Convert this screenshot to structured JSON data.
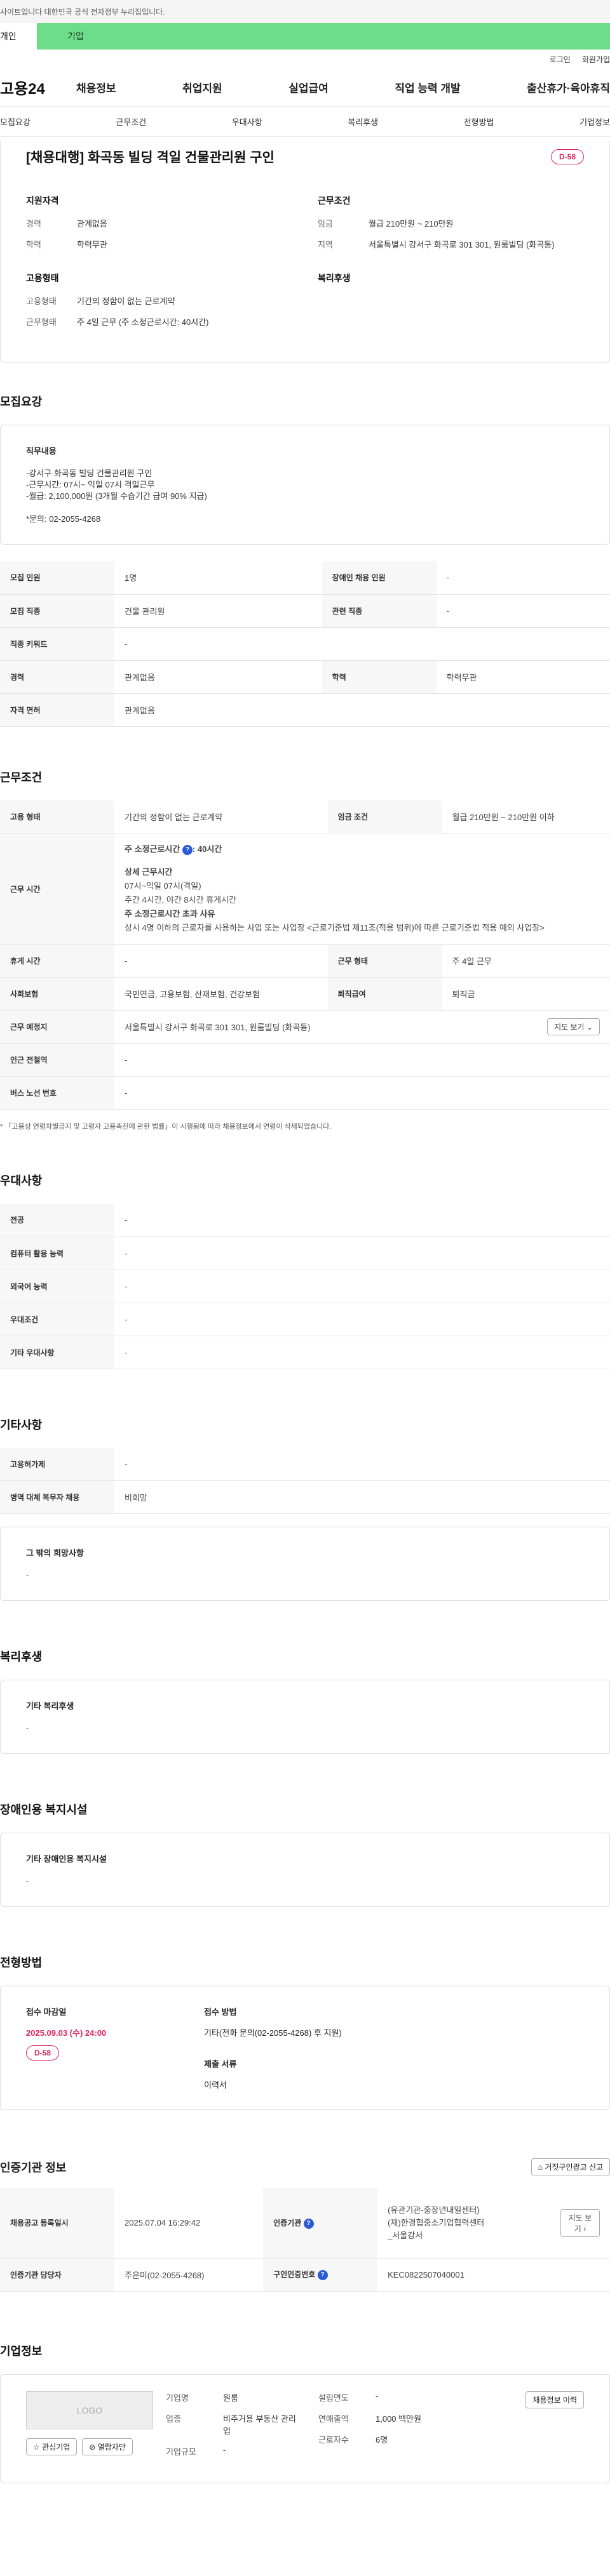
{
  "gov_notice": "사이트입니다 대한민국 공식 전자정부 누리집입니다.",
  "type_tabs": {
    "personal": "개인",
    "company": "기업"
  },
  "util": {
    "login": "로그인",
    "join": "회원가입"
  },
  "gnb": {
    "logo": "고용24",
    "menu": [
      "채용정보",
      "취업지원",
      "실업급여",
      "직업 능력 개발",
      "출산휴가·육아휴직"
    ]
  },
  "sub_tabs": [
    "모집요강",
    "근무조건",
    "우대사항",
    "복리후생",
    "전형방법",
    "기업정보"
  ],
  "job": {
    "title": "[채용대행] 화곡동 빌딩 격일 건물관리원 구인",
    "dday": "D-58",
    "summary": {
      "qual_title": "지원자격",
      "qual": [
        {
          "k": "경력",
          "v": "관계없음"
        },
        {
          "k": "학력",
          "v": "학력무관"
        }
      ],
      "cond_title": "근무조건",
      "cond": [
        {
          "k": "임금",
          "v": "월급 210만원 ~ 210만원"
        },
        {
          "k": "지역",
          "v": "서울특별시 강서구 화곡로 301 301, 원룸빌딩 (화곡동)"
        }
      ],
      "emp_title": "고용형태",
      "emp": [
        {
          "k": "고용형태",
          "v": "기간의 정함이 없는 근로계약"
        },
        {
          "k": "근무형태",
          "v": "주 4일 근무 (주 소정근로시간: 40시간)"
        }
      ],
      "welfare_title": "복리후생"
    }
  },
  "recruit": {
    "section_title": "모집요강",
    "duty_title": "직무내용",
    "duty_lines": [
      "-강서구 화곡동 빌딩 건물관리원 구인",
      "-근무시간: 07시~ 익일 07시 격일근무",
      "-월급: 2,100,000원 (3개월 수습기간 급여 90% 지급)",
      "",
      "*문의: 02-2055-4268"
    ],
    "rows": [
      {
        "k1": "모집 인원",
        "v1": "1명",
        "k2": "장애인 채용 인원",
        "v2": "-"
      },
      {
        "k1": "모집 직종",
        "v1": "건물 관리원",
        "k2": "관련 직종",
        "v2": "-"
      },
      {
        "k1": "직종 키워드",
        "v1": "-",
        "k2": "",
        "v2": ""
      },
      {
        "k1": "경력",
        "v1": "관계없음",
        "k2": "학력",
        "v2": "학력무관"
      },
      {
        "k1": "자격 면허",
        "v1": "관계없음",
        "k2": "",
        "v2": ""
      }
    ]
  },
  "conditions": {
    "section_title": "근무조건",
    "emp_type_k": "고용 형태",
    "emp_type_v": "기간의 정함이 없는 근로계약",
    "wage_k": "임금 조건",
    "wage_v": "월급 210만원 ~ 210만원 이하",
    "hours_k": "근무 시간",
    "hours_main": "주 소정근로시간",
    "hours_main_v": ": 40시간",
    "hours_detail_title": "상세 근무시간",
    "hours_detail": [
      "07시~익일 07시(격일)",
      "주간 4시간, 야간 8시간 휴게시간"
    ],
    "hours_over_title": "주 소정근로시간 초과 사유",
    "hours_over": "상시 4명 이하의 근로자를 사용하는 사업 또는 사업장 <근로기준법 제11조(적용 범위)에 따른 근로기준법 적용 예외 사업장>",
    "holiday_k": "휴게 시간",
    "holiday_v": "-",
    "worktype_k": "근무 형태",
    "worktype_v": "주 4일 근무",
    "insurance_k": "사회보험",
    "insurance_v": "국민연금, 고용보험, 산재보험, 건강보험",
    "retire_k": "퇴직급여",
    "retire_v": "퇴직금",
    "place_k": "근무 예정지",
    "place_v": "서울특별시 강서구 화곡로 301 301, 원룸빌딩 (화곡동)",
    "map_btn": "지도 보기",
    "subway_k": "인근 전철역",
    "subway_v": "-",
    "bus_k": "버스 노선 번호",
    "bus_v": "-",
    "note": "* 「고용상 연령차별금지 및 고령자 고용촉진에 관한 법률」이 시행됨에 따라 채용정보에서 연령이 삭제되었습니다."
  },
  "preference": {
    "section_title": "우대사항",
    "rows": [
      {
        "k": "전공",
        "v": "-"
      },
      {
        "k": "컴퓨터 활용 능력",
        "v": "-"
      },
      {
        "k": "외국어 능력",
        "v": "-"
      },
      {
        "k": "우대조건",
        "v": "-"
      },
      {
        "k": "기타 우대사항",
        "v": "-"
      }
    ]
  },
  "etc": {
    "section_title": "기타사항",
    "rows": [
      {
        "k": "고용허가제",
        "v": "-"
      },
      {
        "k": "병역 대체 복무자 채용",
        "v": "비희망"
      }
    ],
    "other_title": "그 밖의 희망사항",
    "other_v": "-"
  },
  "welfare": {
    "section_title": "복리후생",
    "sub_title": "기타 복리후생",
    "v": "-"
  },
  "disabled": {
    "section_title": "장애인용 복지시설",
    "sub_title": "기타 장애인용 복지시설",
    "v": "-"
  },
  "method": {
    "section_title": "전형방법",
    "deadline_title": "접수 마감일",
    "deadline": "2025.09.03 (수) 24:00",
    "dday": "D-58",
    "how_title": "접수 방법",
    "how": "기타(전화 문의(02-2055-4268) 후 지원)",
    "docs_title": "제출 서류",
    "docs": "이력서"
  },
  "cert": {
    "section_title": "인증기관 정보",
    "report_btn": "거짓구인광고 신고",
    "reg_k": "채용공고 등록일시",
    "reg_v": "2025.07.04 16:29:42",
    "org_k": "인증기관",
    "org_v": [
      "(유관기관-중장년내일센터)",
      "(재)한경협중소기업협력센터",
      "_서울강서"
    ],
    "map_btn": "지도 보기",
    "mgr_k": "인증기관 담당자",
    "mgr_v": "주은미(02-2055-4268)",
    "no_k": "구인인증번호",
    "no_v": "KEC0822507040001"
  },
  "company": {
    "section_title": "기업정보",
    "logo": "LOGO",
    "fav_btn": "관심기업",
    "block_btn": "열람차단",
    "rows_left": [
      {
        "k": "기업명",
        "v": "원룸"
      },
      {
        "k": "업종",
        "v": "비주거용 부동산 관리업"
      },
      {
        "k": "기업규모",
        "v": "-"
      }
    ],
    "rows_right": [
      {
        "k": "설립연도",
        "v": "-"
      },
      {
        "k": "연매출액",
        "v": "1,000 백만원"
      },
      {
        "k": "근로자수",
        "v": "6명"
      }
    ],
    "history_btn": "채용정보 이력"
  }
}
